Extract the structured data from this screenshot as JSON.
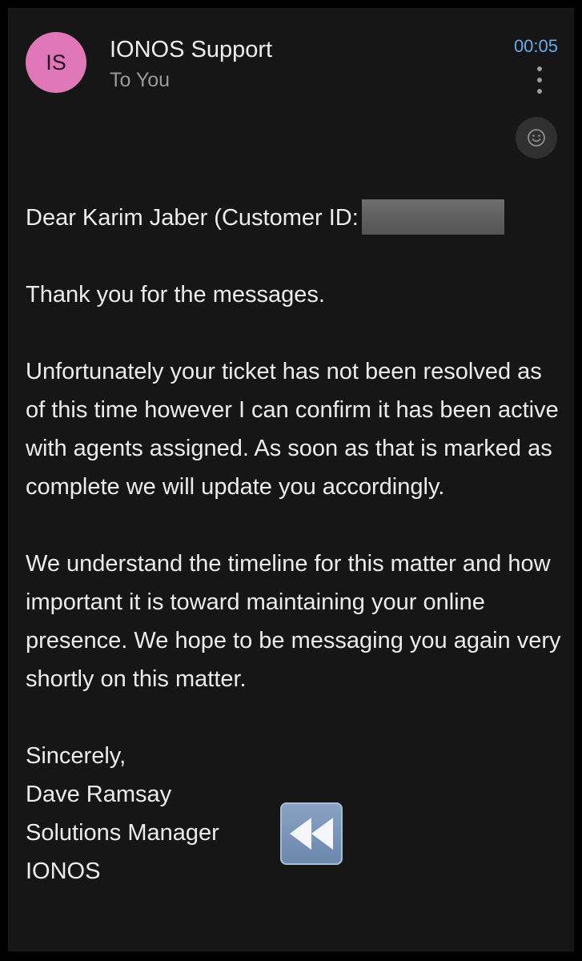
{
  "header": {
    "avatar_initials": "IS",
    "sender": "IONOS Support",
    "recipient": "To You",
    "time": "00:05"
  },
  "icons": {
    "more": "more-vertical-icon",
    "reaction": "smiley-icon",
    "rewind": "fast-rewind-emoji-icon"
  },
  "colors": {
    "background": "#161616",
    "avatar": "#e077b9",
    "time": "#6aa8ea"
  },
  "body": {
    "greeting": "Dear Karim Jaber (Customer ID:",
    "paragraph1": "Thank you for the messages.",
    "paragraph2": "Unfortunately your ticket has not been resolved as of this time however I can confirm it has been active with agents assigned.  As soon as that is marked as complete we will update you accordingly.",
    "paragraph3": "We understand the timeline for this matter and how important it is toward maintaining your online presence.  We hope to be messaging you again very shortly on this matter."
  },
  "signature": {
    "closing": "Sincerely,",
    "name": "Dave Ramsay",
    "title": "Solutions Manager",
    "company": "IONOS"
  }
}
